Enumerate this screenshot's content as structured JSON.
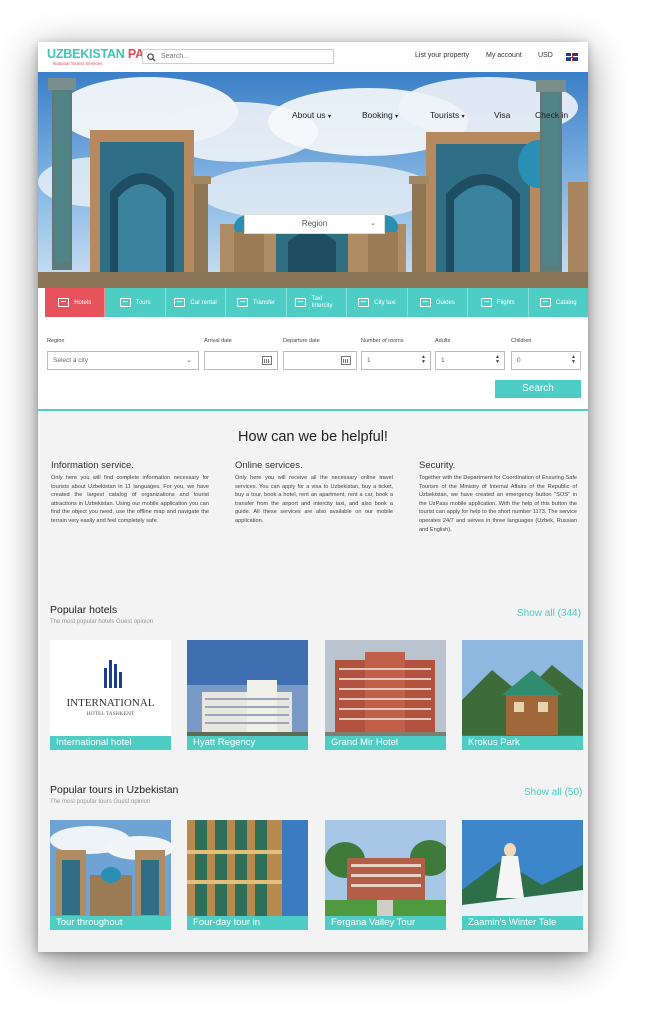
{
  "brand": {
    "name_part1": "UZBEKISTAN",
    "name_part2": "PASS",
    "tagline": "National Tourist Services"
  },
  "search": {
    "placeholder": "Search..."
  },
  "top_links": {
    "list_property": "List your property",
    "account": "My account",
    "currency": "USD"
  },
  "nav": {
    "about": "About us",
    "booking": "Booking",
    "tourists": "Tourists",
    "visa": "Visa",
    "checkin": "Check in"
  },
  "hero": {
    "region_select": "Region"
  },
  "tabs": [
    {
      "label": "Hotels",
      "icon": "hotel-icon"
    },
    {
      "label": "Tours",
      "icon": "tour-icon"
    },
    {
      "label": "Car rental",
      "icon": "car-icon"
    },
    {
      "label": "Transfer",
      "icon": "transfer-icon"
    },
    {
      "label": "Taxi Intercity",
      "icon": "taxi-icon"
    },
    {
      "label": "City taxi",
      "icon": "city-taxi-icon"
    },
    {
      "label": "Guides",
      "icon": "guide-icon"
    },
    {
      "label": "Flights",
      "icon": "plane-icon"
    },
    {
      "label": "Catalog",
      "icon": "catalog-icon"
    }
  ],
  "form": {
    "region_label": "Region",
    "region_placeholder": "Select a city",
    "arrival_label": "Arrival date",
    "departure_label": "Departure date",
    "rooms_label": "Number of rooms",
    "rooms_value": "1",
    "adults_label": "Adults",
    "adults_value": "1",
    "children_label": "Children",
    "children_value": "0",
    "search_button": "Search"
  },
  "helpful": {
    "title": "How can we be helpful!",
    "columns": [
      {
        "title": "Information service.",
        "text": "Only here you will find complete information necessary for tourists about Uzbekistan in 11 languages. For you, we have created the largest catalog of organizations and tourist attractions in Uzbekistan. Using our mobile application you can find the object you need, use the offline map and navigate the terrain very easily and feel completely safe."
      },
      {
        "title": "Online services.",
        "text": "Only here you will receive all the necessary online travel services. You can apply for a visa to Uzbekistan, buy a ticket, buy a tour, book a hotel, rent an apartment, rent a car, book a transfer from the airport and intercity taxi, and also book a guide. All these services are also available on our mobile application."
      },
      {
        "title": "Security.",
        "text": "Together with the Department for Coordination of Ensuring Safe Tourism of the Ministry of Internal Affairs of the Republic of Uzbekistan, we have created an emergency button \"SOS\" in the UzPass mobile application. With the help of this button the tourist can apply for help to the short number 1173. The service operates 24/7 and serves in three languages (Uzbek, Russian and English)."
      }
    ]
  },
  "popular_hotels": {
    "title": "Popular hotels",
    "subtitle": "The most popular hotels Guest opinion",
    "show_all": "Show all (344)",
    "items": [
      {
        "name": "International hotel",
        "logo_word": "INTERNATIONAL",
        "logo_sub": "HOTEL TASHKENT"
      },
      {
        "name": "Hyatt Regency"
      },
      {
        "name": "Grand Mir Hotel"
      },
      {
        "name": "Krokus Park"
      }
    ]
  },
  "popular_tours": {
    "title": "Popular tours in Uzbekistan",
    "subtitle": "The most popular tours Guest opinion",
    "show_all": "Show all (50)",
    "items": [
      {
        "name": "Tour throughout"
      },
      {
        "name": "Four-day tour in"
      },
      {
        "name": "Fergana Valley Tour"
      },
      {
        "name": "Zaamin's Winter Tale"
      }
    ]
  },
  "colors": {
    "accent": "#4ecdc4",
    "active_tab": "#e8535b",
    "brand_red": "#e14b5a"
  }
}
